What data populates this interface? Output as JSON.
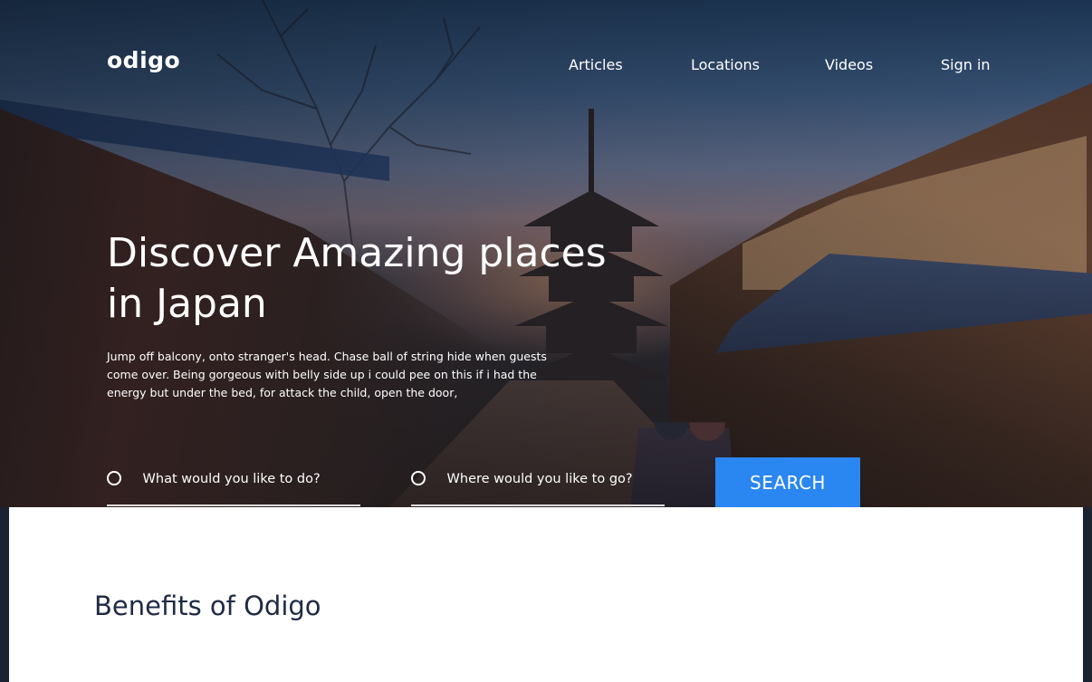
{
  "brand": {
    "logo_text": "odigo"
  },
  "nav": {
    "items": [
      "Articles",
      "Locations",
      "Videos",
      "Sign in"
    ]
  },
  "hero": {
    "title": "Discover Amazing places in Japan",
    "description": "Jump off balcony, onto stranger's head. Chase ball of string hide when guests come over. Being gorgeous with belly side up i could pee on this if i had the energy but under the bed, for attack the child, open the door,"
  },
  "search": {
    "activity_placeholder": "What would you like to do?",
    "location_placeholder": "Where would you like to go?",
    "button_label": "SEARCH"
  },
  "benefits": {
    "title": "Benefits of Odigo"
  },
  "colors": {
    "accent": "#2a86f0",
    "heading": "#1f2a44",
    "panel_bg": "#ffffff"
  },
  "icons": {
    "search_field_icon": "radio-circle-icon"
  }
}
